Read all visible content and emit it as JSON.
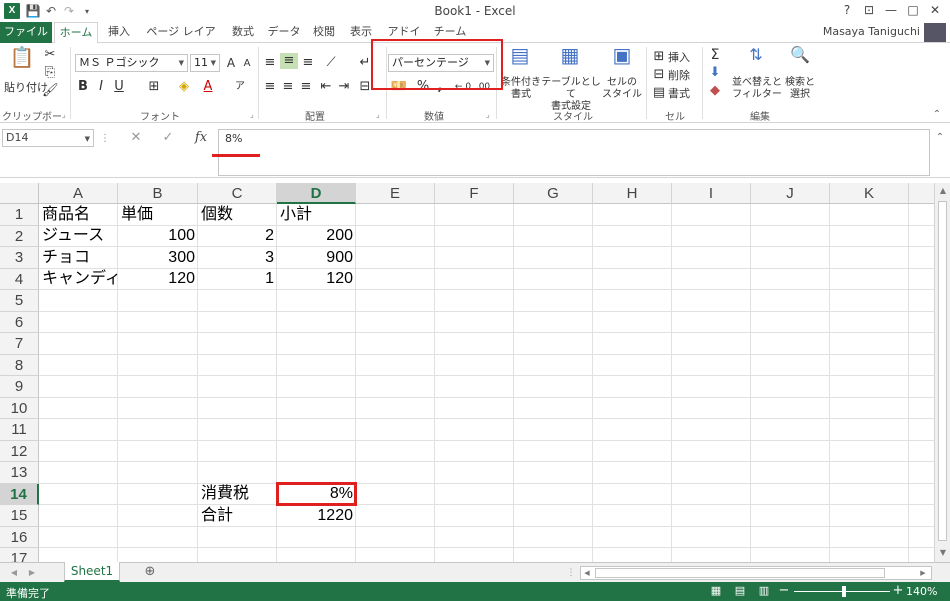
{
  "app": {
    "title": "Book1 - Excel",
    "user": "Masaya Taniguchi"
  },
  "qat": {
    "logo": "X",
    "save_icon": "save-icon",
    "undo_icon": "undo-icon",
    "redo_icon": "redo-icon"
  },
  "tabs": [
    "ファイル",
    "ホーム",
    "挿入",
    "ページ レイアウト",
    "数式",
    "データ",
    "校閲",
    "表示",
    "アドイン",
    "チーム"
  ],
  "window_controls": [
    "?",
    "⊡",
    "—",
    "□",
    "✕"
  ],
  "ribbon": {
    "clipboard": {
      "label": "クリップボード",
      "paste": "貼り付け"
    },
    "font": {
      "label": "フォント",
      "font_name": "ＭＳ Ｐゴシック",
      "font_size": "11",
      "grow": "A",
      "shrink": "A",
      "bold": "B",
      "italic": "I",
      "underline": "U"
    },
    "alignment": {
      "label": "配置"
    },
    "number": {
      "label": "数値",
      "format": "パーセンテージ",
      "percent": "%",
      "comma": ","
    },
    "styles": {
      "label": "スタイル",
      "conditional": "条件付き\n書式",
      "table": "テーブルとして\n書式設定",
      "cell": "セルの\nスタイル"
    },
    "cells": {
      "label": "セル",
      "insert": "挿入",
      "delete": "削除",
      "format": "書式"
    },
    "editing": {
      "label": "編集",
      "sort": "並べ替えと\nフィルター",
      "find": "検索と\n選択"
    }
  },
  "formula_bar": {
    "name_box": "D14",
    "content": "8%",
    "fx": "fx",
    "cancel": "✕",
    "enter": "✓"
  },
  "grid": {
    "columns": [
      "A",
      "B",
      "C",
      "D",
      "E",
      "F",
      "G",
      "H",
      "I",
      "J",
      "K"
    ],
    "selected_column": "D",
    "rows": [
      "1",
      "2",
      "3",
      "4",
      "5",
      "6",
      "7",
      "8",
      "9",
      "10",
      "11",
      "12",
      "13",
      "14",
      "15",
      "16",
      "17"
    ],
    "selected_row": "14",
    "cells": {
      "A1": "商品名",
      "B1": "単価",
      "C1": "個数",
      "D1": "小計",
      "A2": "ジュース",
      "B2": "100",
      "C2": "2",
      "D2": "200",
      "A3": "チョコ",
      "B3": "300",
      "C3": "3",
      "D3": "900",
      "A4": "キャンディ",
      "B4": "120",
      "C4": "1",
      "D4": "120",
      "C14": "消費税",
      "D14": "8%",
      "C15": "合計",
      "D15": "1220"
    }
  },
  "sheets": {
    "active": "Sheet1",
    "add": "⊕"
  },
  "status": {
    "text": "準備完了",
    "zoom": "140%"
  },
  "colors": {
    "accent": "#217346",
    "highlight": "#e0201f"
  }
}
